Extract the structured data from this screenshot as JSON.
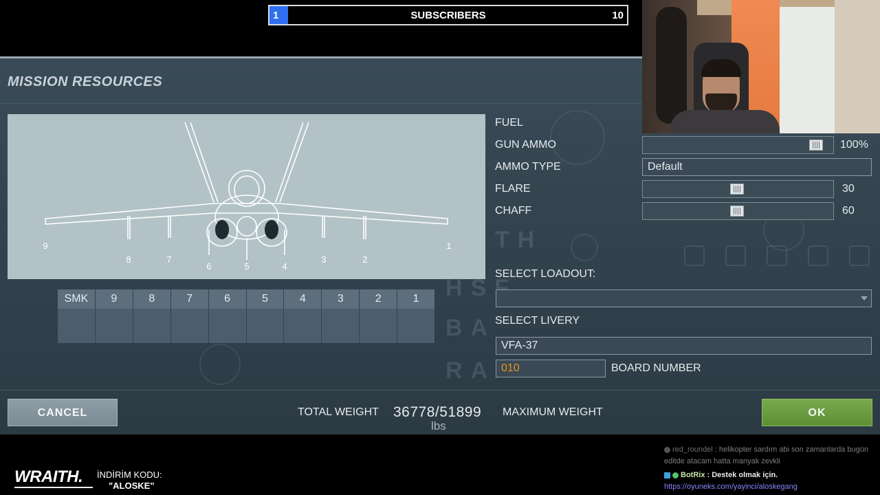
{
  "overlay": {
    "subscribers": {
      "title": "SUBSCRIBERS",
      "min": "1",
      "max": "10",
      "progress": 0.1
    }
  },
  "panel": {
    "title": "MISSION RESOURCES",
    "pylon_labels": [
      "9",
      "8",
      "7",
      "6",
      "5",
      "4",
      "3",
      "2",
      "1"
    ],
    "pylons": [
      "SMK",
      "9",
      "8",
      "7",
      "6",
      "5",
      "4",
      "3",
      "2",
      "1"
    ],
    "form": {
      "fuel_label": "FUEL",
      "gun_ammo_label": "GUN AMMO",
      "gun_ammo_value": "100%",
      "gun_ammo_level": 1.0,
      "ammo_type_label": "AMMO TYPE",
      "ammo_type_value": "Default",
      "flare_label": "FLARE",
      "flare_value": "30",
      "flare_level": 0.5,
      "chaff_label": "CHAFF",
      "chaff_value": "60",
      "chaff_level": 0.5,
      "loadout_label": "SELECT LOADOUT:",
      "loadout_value": "",
      "livery_label": "SELECT LIVERY",
      "livery_value": "VFA-37",
      "board_number_value": "010",
      "board_number_label": "BOARD NUMBER"
    },
    "footer": {
      "cancel": "CANCEL",
      "ok": "OK",
      "total_weight_label": "TOTAL WEIGHT",
      "weight_value": "36778/51899",
      "max_weight_label": "MAXIMUM WEIGHT",
      "unit": "lbs"
    }
  },
  "chat": {
    "line1_user": "red_roundel",
    "line1_msg": " : helikopter sardım abi son zamanlarda bugün editde atacam hatta manyak zevkli",
    "line2_user": "BotRix",
    "line2_msg": " : Destek olmak için.",
    "line2_link": "https://oyuneks.com/yayinci/aloskegang"
  },
  "sponsor": {
    "brand": "WRAITH.",
    "discount_label": "İNDİRİM KODU:",
    "code": "\"ALOSKE\""
  },
  "colors": {
    "ok_green": "#6a9a3e",
    "board_orange": "#e8961e",
    "progress_blue": "#2f6ff0"
  }
}
